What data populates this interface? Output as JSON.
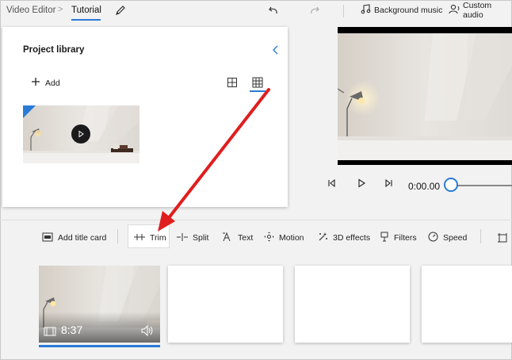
{
  "header": {
    "app_name": "Video Editor",
    "breadcrumb_separator": ">",
    "project_name": "Tutorial",
    "rename_icon": "pencil-icon",
    "undo_icon": "undo-icon",
    "redo_icon": "redo-icon",
    "background_music_label": "Background music",
    "custom_audio_label": "Custom audio"
  },
  "library": {
    "title": "Project library",
    "add_label": "Add",
    "collapse_icon": "chevron-left-icon",
    "view_modes": [
      "small-grid-icon",
      "large-grid-icon"
    ],
    "selected_view": "large-grid-icon"
  },
  "player": {
    "time": "0:00.00",
    "progress": 0
  },
  "storyboard": {
    "tools": {
      "title_card": "Add title card",
      "trim": "Trim",
      "split": "Split",
      "text": "Text",
      "motion": "Motion",
      "effects_3d": "3D effects",
      "filters": "Filters",
      "speed": "Speed"
    },
    "highlighted_tool": "Trim",
    "clip": {
      "duration": "8:37"
    }
  },
  "colors": {
    "accent": "#2a7bd6",
    "annotation_arrow": "#e01e1e"
  }
}
